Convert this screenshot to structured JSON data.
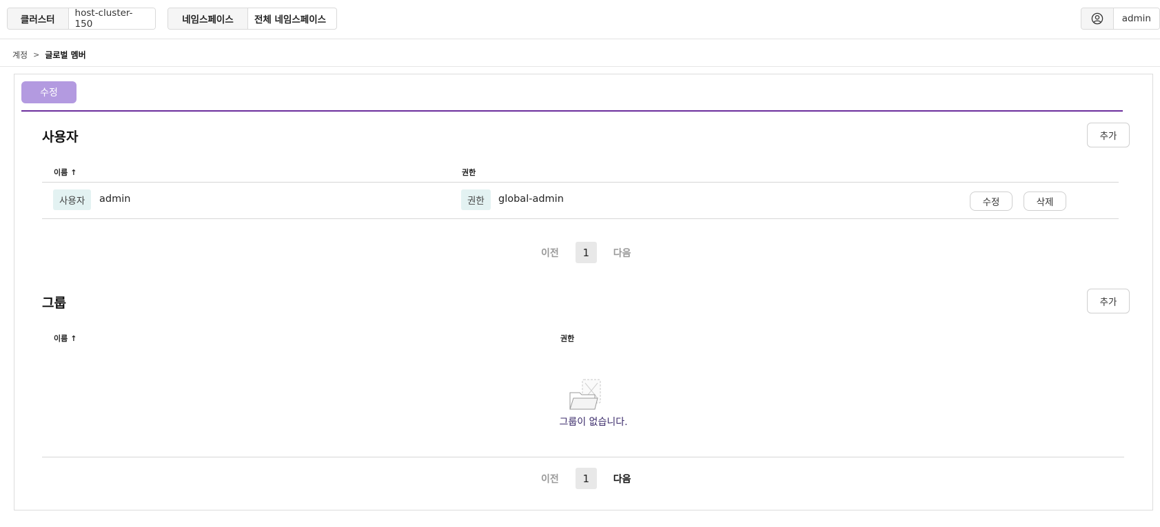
{
  "topbar": {
    "cluster_label": "클러스터",
    "cluster_value": "host-cluster-150",
    "namespace_label": "네임스페이스",
    "namespace_value": "전체 네임스페이스",
    "user_icon": "user-circle-icon",
    "user_name": "admin"
  },
  "breadcrumb": {
    "parent": "계정",
    "separator_icon": "chevron-right-icon",
    "current": "글로벌 멤버"
  },
  "toolbar": {
    "edit_label": "수정",
    "accent_color": "#b39ae0",
    "divider_color": "#6a2d9c"
  },
  "users_section": {
    "title": "사용자",
    "add_label": "추가",
    "columns": [
      "이름",
      "권한"
    ],
    "sort_icon": "arrow-up-icon",
    "rows": [
      {
        "type_tag": "사용자",
        "name": "admin",
        "role_tag": "권한",
        "role": "global-admin",
        "edit_label": "수정",
        "delete_label": "삭제"
      }
    ],
    "pager": {
      "prev": "이전",
      "page": "1",
      "next": "다음"
    }
  },
  "groups_section": {
    "title": "그룹",
    "add_label": "추가",
    "columns": [
      "이름",
      "권한"
    ],
    "sort_icon": "arrow-up-icon",
    "empty_icon": "empty-folder-icon",
    "empty_text": "그룹이 없습니다.",
    "pager": {
      "prev": "이전",
      "page": "1",
      "next": "다음"
    }
  }
}
